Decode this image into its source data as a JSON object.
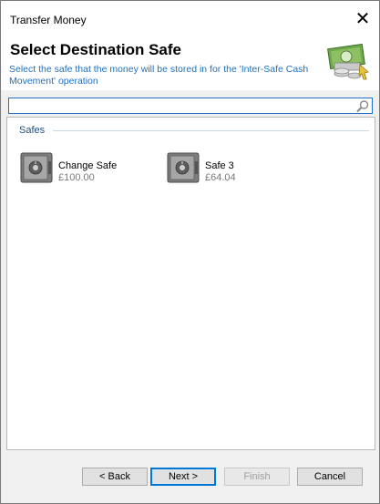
{
  "window": {
    "title": "Transfer Money"
  },
  "header": {
    "title": "Select Destination Safe",
    "description": "Select the safe that the money will be stored in for the 'Inter-Safe Cash Movement' operation"
  },
  "search": {
    "value": "",
    "placeholder": ""
  },
  "group": {
    "label": "Safes"
  },
  "safes": [
    {
      "name": "Change Safe",
      "amount": "£100.00"
    },
    {
      "name": "Safe 3",
      "amount": "£64.04"
    }
  ],
  "buttons": {
    "back": "< Back",
    "next": "Next >",
    "finish": "Finish",
    "cancel": "Cancel"
  },
  "colors": {
    "accent": "#0078d7",
    "header_text": "#1e70c0",
    "group_text": "#1c4e80"
  }
}
